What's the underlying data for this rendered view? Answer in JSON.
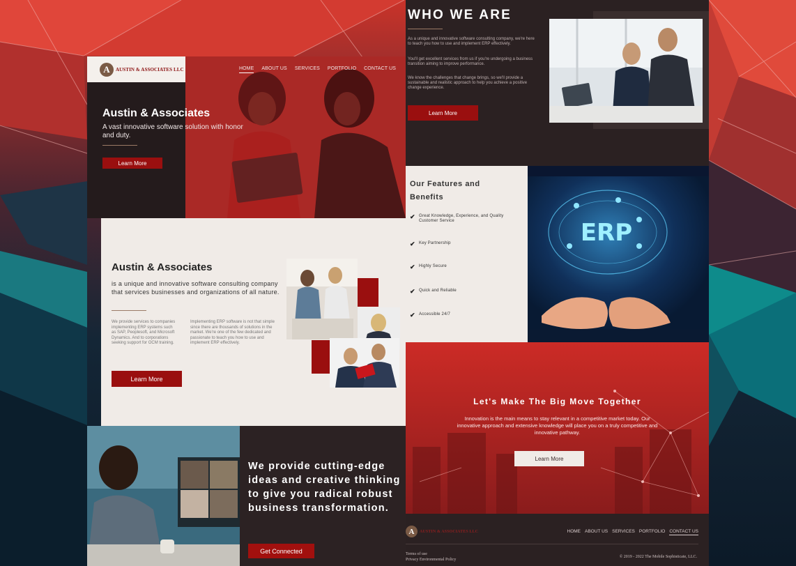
{
  "brand": {
    "logo_letter": "A",
    "logo_text": "AUSTIN & ASSOCIATES LLC",
    "colors": {
      "primary_red": "#9a0f0f",
      "dark": "#2b2122",
      "cream": "#f0ebe7",
      "accent_rule": "#9b7a66"
    }
  },
  "nav": {
    "items": [
      "HOME",
      "ABOUT US",
      "SERVICES",
      "PORTFOLIO",
      "CONTACT US"
    ],
    "active": "HOME"
  },
  "hero": {
    "title": "Austin & Associates",
    "subtitle": "A vast innovative software solution with honor and duty.",
    "cta": "Learn More"
  },
  "who_we_are": {
    "title": "WHO WE ARE",
    "paragraphs": [
      "As a unique and innovative software consulting company, we're here to teach you how to use and implement ERP effectively.",
      "You'll get excellent services from us if you're undergoing a business transition aiming to improve performance.",
      "We know the challenges that change brings, so we'll provide a sustainable and realistic approach to help you achieve a positive change experience."
    ],
    "cta": "Learn More"
  },
  "about": {
    "title": "Austin & Associates",
    "lead": "is a unique and innovative software consulting company that services businesses and organizations of all nature.",
    "col1": "We provide services to companies implementing ERP systems such as SAP, Peoplesoft, and Microsoft Dynamics. And to corporations seeking support for OCM training.",
    "col2": "Implementing ERP software is not that simple since there are thousands of solutions in the market. We're one of the few dedicated and passionate to teach you how to use and implement ERP effectively.",
    "cta": "Learn More"
  },
  "features": {
    "title": "Our Features and Benefits",
    "items": [
      "Great Knowledge, Experience, and Quality Customer Service",
      "Key Partnership",
      "Highly Secure",
      "Quick and Reliable",
      "Accessible 24/7"
    ],
    "check_icon": "checkmark-icon"
  },
  "erp_image": {
    "label": "ERP"
  },
  "cutting_edge": {
    "heading": "We provide cutting-edge ideas and creative thinking to give you radical robust business transformation.",
    "cta": "Get Connected"
  },
  "big_move": {
    "title": "Let's Make The Big Move Together",
    "text": "Innovation is the main means to stay relevant in a competitive market today. Our innovative approach and extensive knowledge will place you on a truly competitive and innovative pathway.",
    "cta": "Learn More"
  },
  "footer": {
    "nav": [
      "HOME",
      "ABOUT US",
      "SERVICES",
      "PORTFOLIO",
      "CONTACT US"
    ],
    "active": "CONTACT US",
    "legal": [
      "Terms of use",
      "Privacy Environmental Policy"
    ],
    "copyright": "© 2019 - 2022 The Mobile Sophisticate, LLC."
  }
}
